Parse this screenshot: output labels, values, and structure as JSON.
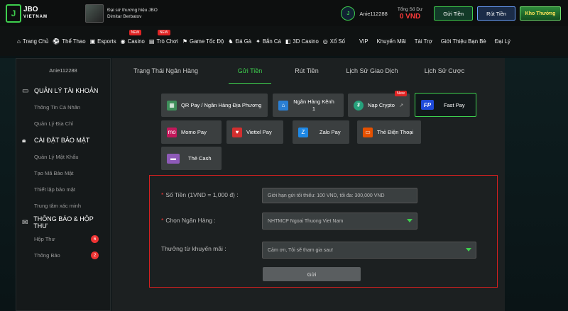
{
  "header": {
    "logo_main": "JBO",
    "logo_sub": "VIETNAM",
    "ambassador_line1": "Đại sứ thương hiệu JBO",
    "ambassador_line2": "Dimitar Berbatov",
    "username": "Anie112288",
    "balance_label": "Tổng Số Dư",
    "balance_value": "0 VND",
    "deposit_btn": "Gửi Tiền",
    "withdraw_btn": "Rút Tiền",
    "rewards_btn": "Kho Thưởng"
  },
  "nav": {
    "items": [
      {
        "label": "Trang Chủ",
        "icon": "home-icon",
        "new": false
      },
      {
        "label": "Thể Thao",
        "icon": "soccer-icon",
        "new": false
      },
      {
        "label": "Esports",
        "icon": "gamepad-icon",
        "new": false
      },
      {
        "label": "Casino",
        "icon": "casino-chip-icon",
        "new": true
      },
      {
        "label": "Trò Chơi",
        "icon": "slot-icon",
        "new": true
      },
      {
        "label": "Game Tốc Độ",
        "icon": "speed-icon",
        "new": false
      },
      {
        "label": "Đá Gà",
        "icon": "rooster-icon",
        "new": false
      },
      {
        "label": "Bắn Cá",
        "icon": "fish-icon",
        "new": false
      },
      {
        "label": "3D Casino",
        "icon": "cube-icon",
        "new": false
      },
      {
        "label": "Xổ Số",
        "icon": "lottery-icon",
        "new": false
      }
    ],
    "right_items": [
      "VIP",
      "Khuyến Mãi",
      "Tài Trợ",
      "Giới Thiệu Bạn Bè",
      "Đại Lý"
    ],
    "new_tag": "NEW"
  },
  "sidebar": {
    "username": "Anie112288",
    "sections": [
      {
        "title": "QUẢN LÝ TÀI KHOẢN",
        "icon": "id-card-icon",
        "items": [
          "Thông Tin Cá Nhân",
          "Quản Lý Địa Chỉ"
        ]
      },
      {
        "title": "CÀI ĐẶT BẢO MẬT",
        "icon": "lock-icon",
        "items": [
          "Quản Lý Mật Khẩu",
          "Tạo Mã Bảo Mật",
          "Thiết lập bảo mật",
          "Trung tâm xác minh"
        ]
      },
      {
        "title": "THÔNG BÁO & HỘP THƯ",
        "icon": "envelope-icon",
        "items": [
          "Hộp Thư",
          "Thông Báo"
        ],
        "badges": [
          "6",
          "2"
        ]
      }
    ]
  },
  "tabs": [
    "Trạng Thái Ngân Hàng",
    "Gửi Tiền",
    "Rút Tiền",
    "Lịch Sử Giao Dịch",
    "Lịch Sử Cược"
  ],
  "payments": [
    {
      "label": "QR Pay / Ngân Hàng Địa Phương",
      "icon": "qr-icon",
      "color": "#3e8e5a"
    },
    {
      "label": "Ngân Hàng Kênh 1",
      "icon": "bank-icon",
      "color": "#2a7fd4"
    },
    {
      "label": "Nạp Crypto",
      "icon": "tether-icon",
      "color": "#26a17b",
      "tag": "New"
    },
    {
      "label": "Fast Pay",
      "icon": "fastpay-icon",
      "color": "#1f4bd8"
    },
    {
      "label": "Momo Pay",
      "icon": "momo-icon",
      "color": "#c2185b"
    },
    {
      "label": "Viettel Pay",
      "icon": "viettel-icon",
      "color": "#d32f2f"
    },
    {
      "label": "Zalo Pay",
      "icon": "zalo-icon",
      "color": "#1e88e5"
    },
    {
      "label": "Thẻ Điện Thoại",
      "icon": "phone-card-icon",
      "color": "#e65100"
    },
    {
      "label": "Thẻ Cash",
      "icon": "cash-card-icon",
      "color": "#8e5ab8"
    }
  ],
  "form": {
    "amount_label": "Số Tiền (1VND = 1,000 đ) :",
    "amount_placeholder": "Giới hạn gửi tối thiểu: 100 VND, tối đa: 300,000 VND",
    "bank_label": "Chọn Ngân Hàng :",
    "bank_value": "NHTMCP Ngoai Thuong Viet Nam",
    "promo_label": "Thưởng từ khuyến mãi :",
    "promo_value": "Cảm ơn, Tôi sẽ tham gia sau!",
    "submit": "Gửi"
  },
  "colors": {
    "accent": "#3ecf4e",
    "error": "#d42020",
    "balance": "#ff3a3a"
  }
}
